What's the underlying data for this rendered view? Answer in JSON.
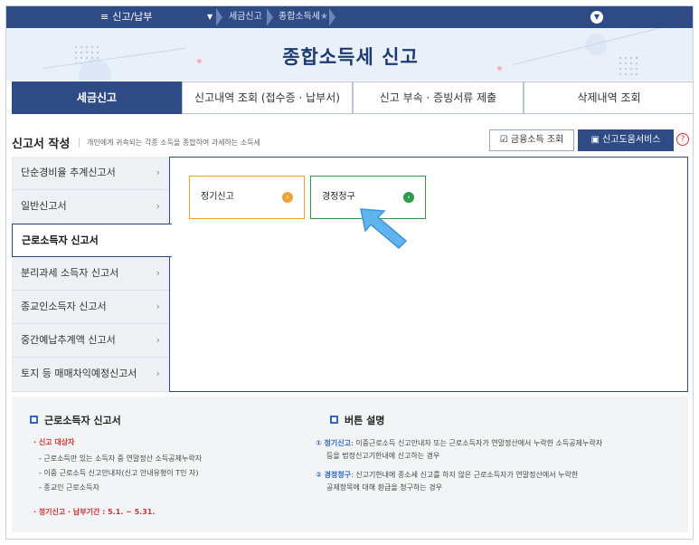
{
  "topbar": {
    "menu_label": "신고/납부",
    "dropdown_icon": "caret-down-icon",
    "breadcrumb_1": "세금신고",
    "breadcrumb_2": "종합소득세",
    "favorite_icon": "star-icon"
  },
  "page_title": "종합소득세 신고",
  "tabs": [
    {
      "label": "세금신고",
      "active": true
    },
    {
      "label": "신고내역 조회 (접수증 · 납부서)"
    },
    {
      "label": "신고 부속 · 증빙서류 제출"
    },
    {
      "label": "삭제내역 조회"
    }
  ],
  "section": {
    "title": "신고서 작성",
    "desc": "개인에게 귀속되는 각종 소득을 종합하여 과세하는 소득세",
    "financial_btn": "금융소득 조회",
    "help_btn": "신고도움서비스",
    "help_icon": "?"
  },
  "left_menu": [
    {
      "label": "단순경비율 추계신고서"
    },
    {
      "label": "일반신고서"
    },
    {
      "label": "근로소득자 신고서",
      "active": true
    },
    {
      "label": "분리과세 소득자 신고서"
    },
    {
      "label": "종교인소득자 신고서"
    },
    {
      "label": "중간예납추계액 신고서"
    },
    {
      "label": "토지 등 매매차익예정신고서"
    }
  ],
  "cards": [
    {
      "label": "정기신고",
      "color": "#e8a43a"
    },
    {
      "label": "경정청구",
      "color": "#2f9a4c"
    }
  ],
  "info": {
    "left_title": "근로소득자 신고서",
    "target_label": "· 신고 대상자",
    "target_items": [
      "- 근로소득만 있는 소득자 중 연말정산 소득공제누락자",
      "- 이중 근로소득 신고안내자(신고 안내유형이 T인 자)",
      "- 종교인 근로소득자"
    ],
    "period_label": "· 정기신고 · 납부기간 :",
    "period_value": "5.1. ~ 5.31.",
    "right_title": "버튼 설명",
    "r1_head": "① 정기신고",
    "r1_text": ": 이중근로소득 신고안내자 또는 근로소득자가 연말정산에서 누락한 소득공제누락자",
    "r1_text2": "등을 법정신고기한내에 신고하는 경우",
    "r2_head": "② 경정청구",
    "r2_text": ": 신고기한내에 종소세 신고를 하지 않은 근로소득자가 연말정산에서 누락한",
    "r2_text2": "공제항목에 대해 환급을 청구하는 경우"
  }
}
